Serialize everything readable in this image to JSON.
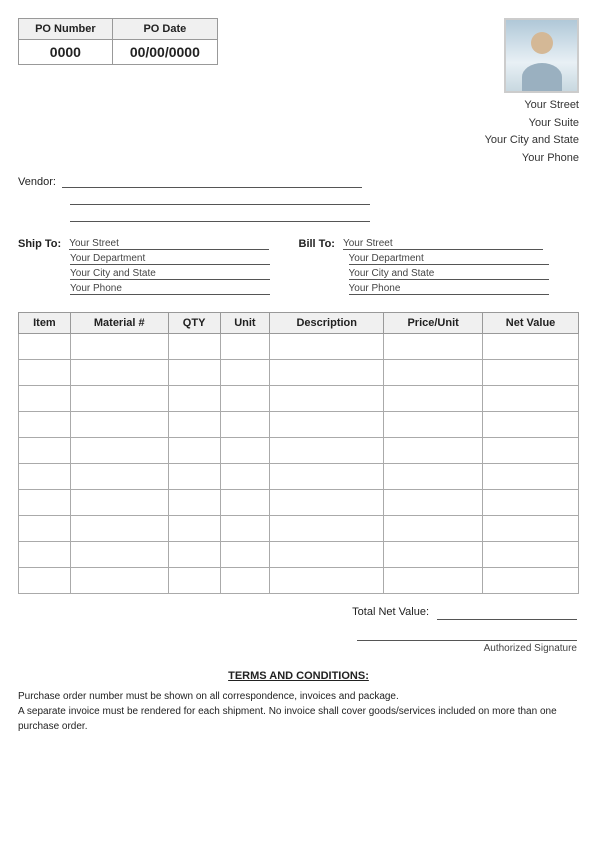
{
  "po": {
    "number_label": "PO Number",
    "date_label": "PO Date",
    "number_value": "0000",
    "date_value": "00/00/0000"
  },
  "company": {
    "street": "Your Street",
    "suite": "Your Suite",
    "city_state": "Your City and State",
    "phone": "Your Phone"
  },
  "vendor": {
    "label": "Vendor:",
    "line1": "",
    "line2": "",
    "line3": ""
  },
  "ship_to": {
    "label": "Ship To:",
    "street": "Your Street",
    "department": "Your Department",
    "city_state": "Your City and State",
    "phone": "Your Phone"
  },
  "bill_to": {
    "label": "Bill To:",
    "street": "Your Street",
    "department": "Your Department",
    "city_state": "Your City and State",
    "phone": "Your Phone"
  },
  "table": {
    "headers": [
      "Item",
      "Material #",
      "QTY",
      "Unit",
      "Description",
      "Price/Unit",
      "Net Value"
    ],
    "rows": 10
  },
  "total": {
    "label": "Total Net Value:",
    "value": ""
  },
  "signature": {
    "label": "Authorized Signature"
  },
  "terms": {
    "title": "TERMS AND CONDITIONS:",
    "line1": "Purchase order number must be shown on all correspondence, invoices and package.",
    "line2": "A separate invoice must be rendered for each shipment. No invoice shall cover goods/services included on more than one purchase order."
  }
}
